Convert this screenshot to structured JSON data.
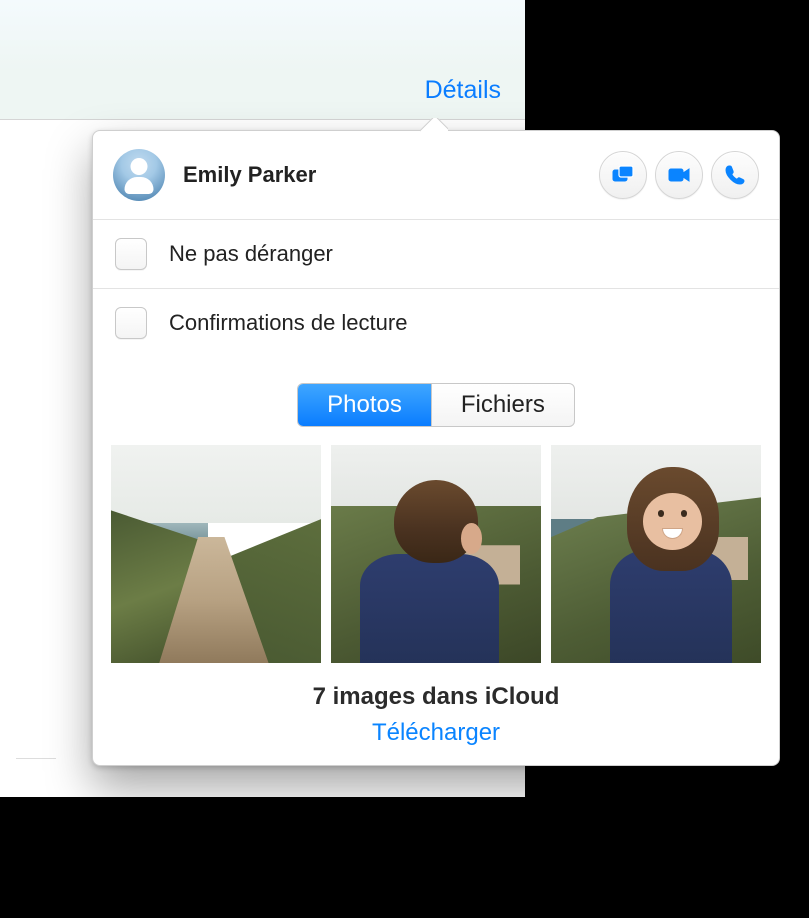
{
  "header": {
    "details_label": "Détails"
  },
  "contact": {
    "name": "Emily Parker"
  },
  "actions": {
    "share_screen": "share-screen",
    "video": "video-call",
    "audio": "audio-call"
  },
  "options": [
    {
      "label": "Ne pas déranger",
      "checked": false
    },
    {
      "label": "Confirmations de lecture",
      "checked": false
    }
  ],
  "tabs": {
    "photos": "Photos",
    "files": "Fichiers",
    "active": "photos"
  },
  "thumbnails": [
    {
      "desc": "coast-path"
    },
    {
      "desc": "girl-back"
    },
    {
      "desc": "girl-smiling"
    }
  ],
  "icloud": {
    "status": "7 images dans iCloud",
    "download": "Télécharger"
  }
}
